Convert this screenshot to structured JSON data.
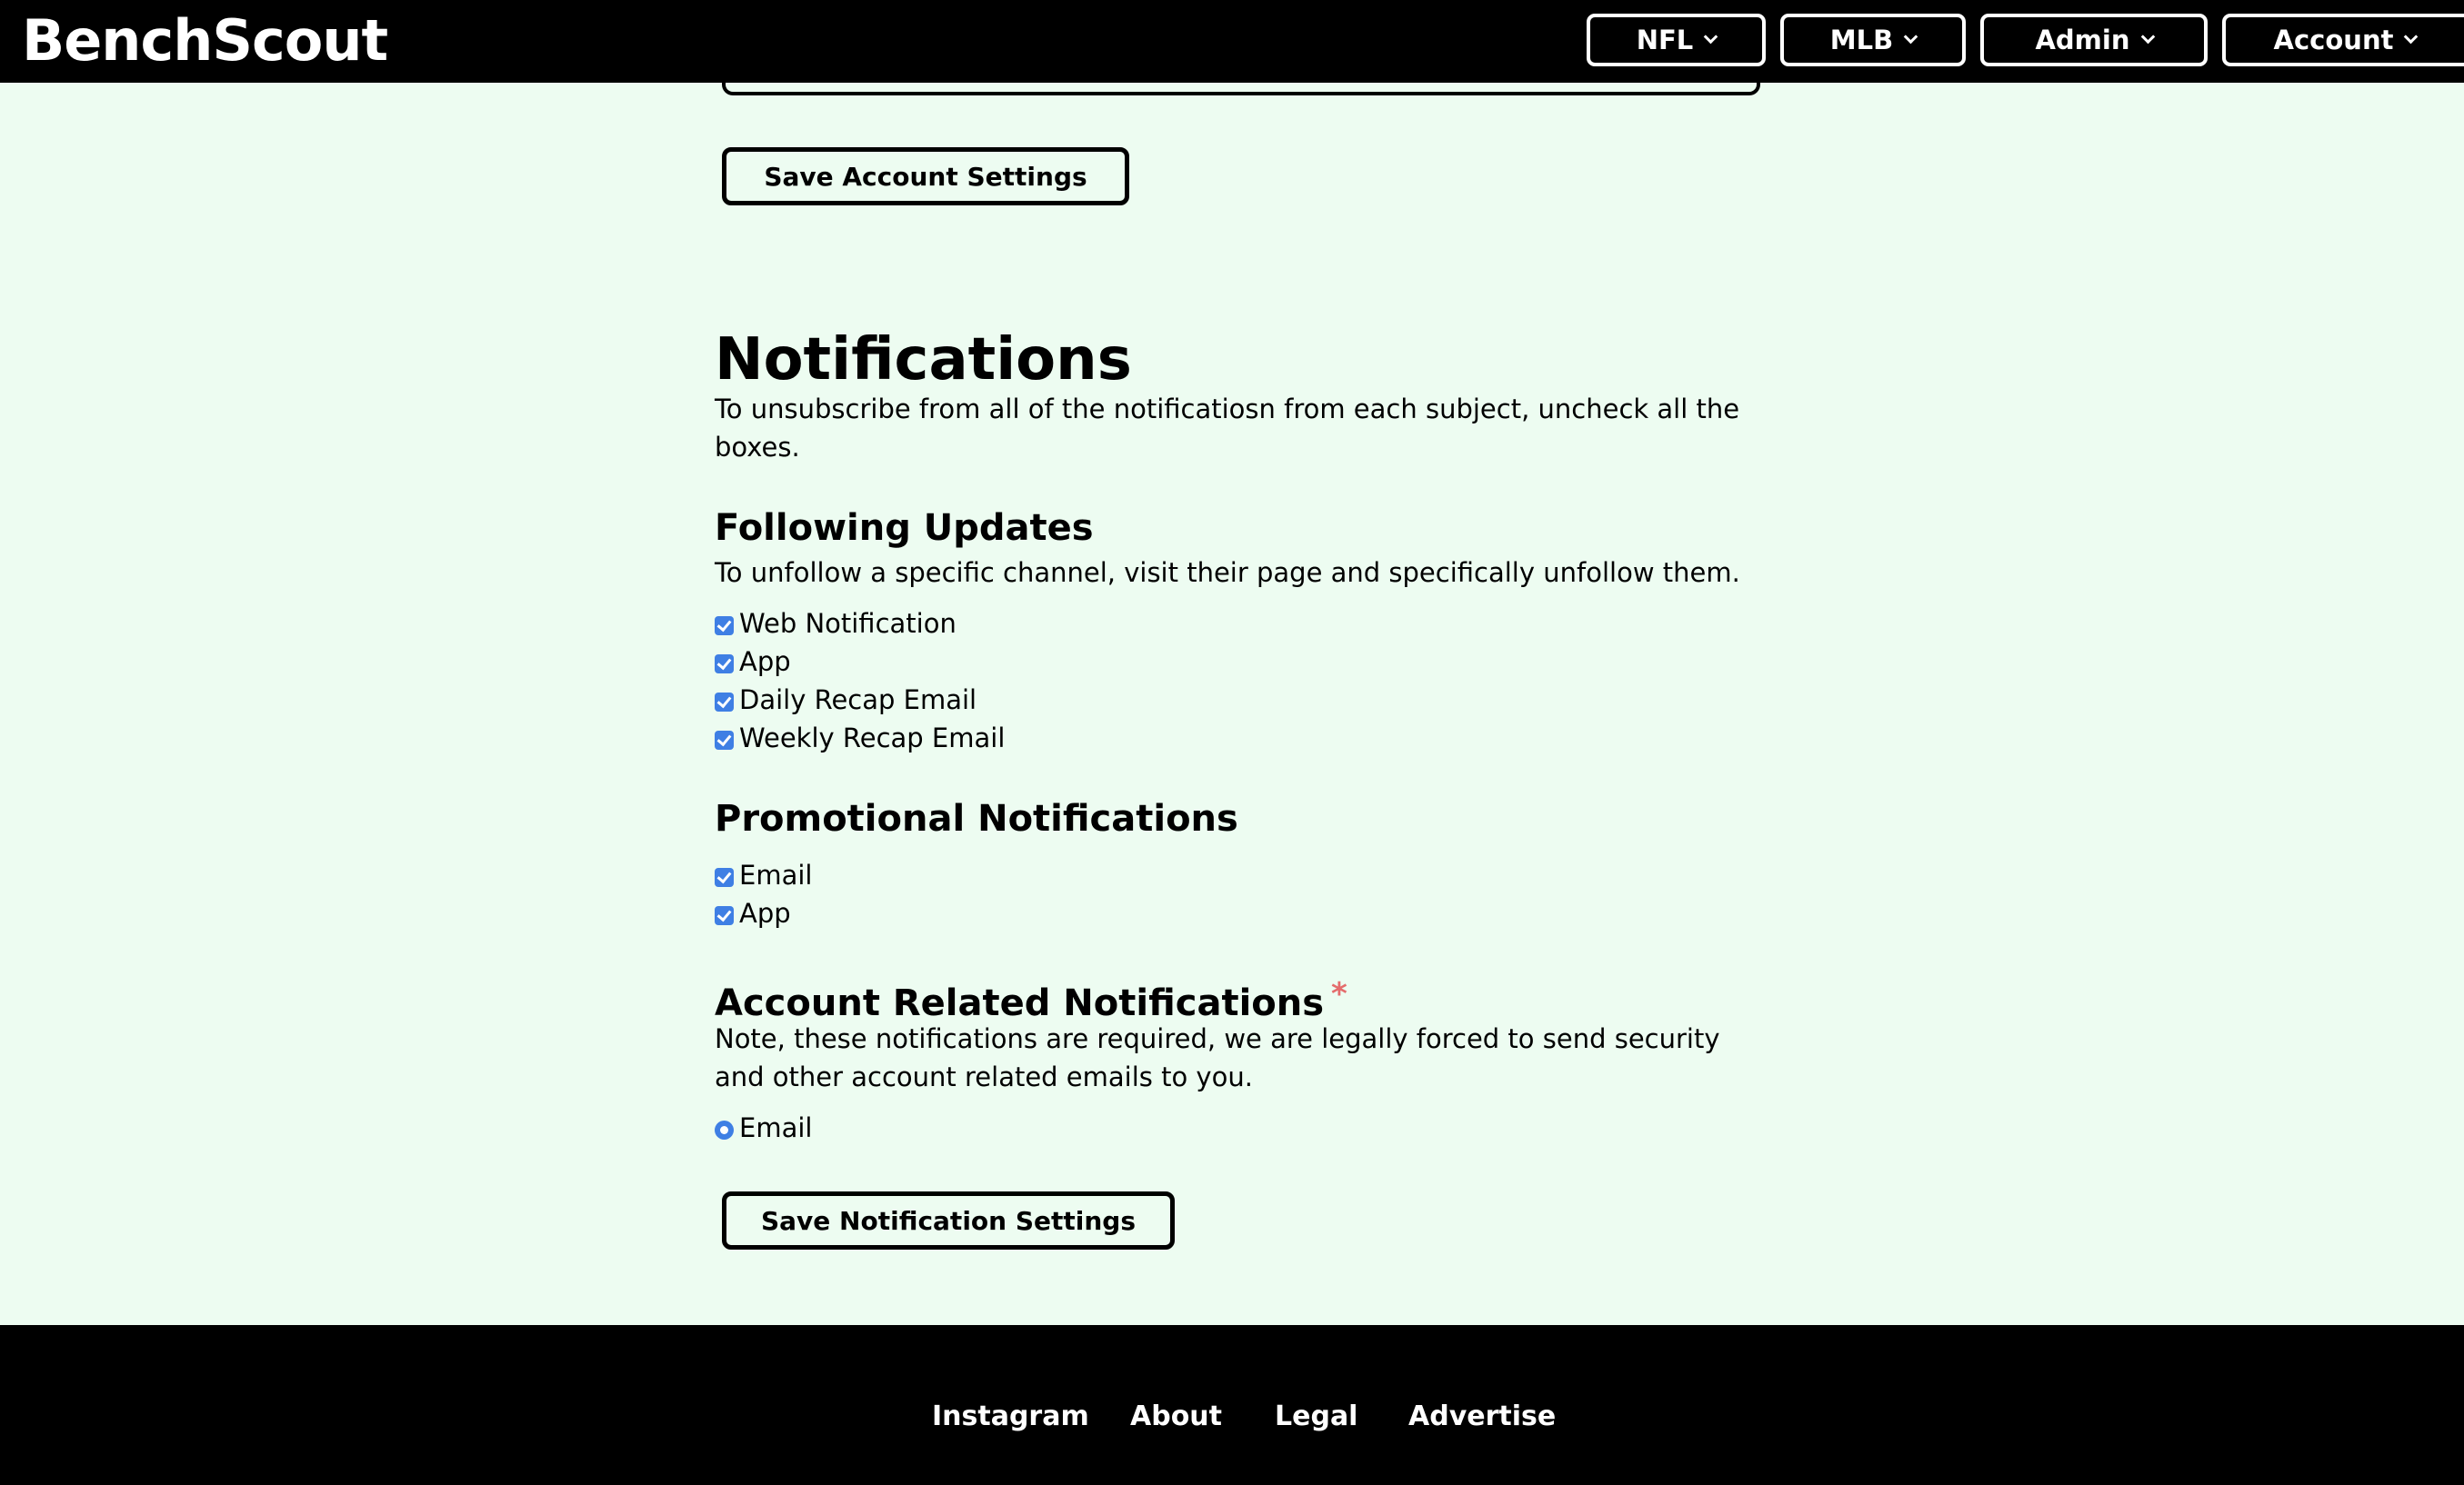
{
  "header": {
    "logo": "BenchScout",
    "nav": [
      {
        "label": "NFL"
      },
      {
        "label": "MLB"
      },
      {
        "label": "Admin"
      },
      {
        "label": "Account"
      }
    ]
  },
  "account_settings": {
    "save_label": "Save Account Settings"
  },
  "notifications": {
    "title": "Notifications",
    "intro": "To unsubscribe from all of the notificatiosn from each subject, uncheck all the boxes.",
    "following": {
      "title": "Following Updates",
      "desc": "To unfollow a specific channel, visit their page and specifically unfollow them.",
      "options": [
        {
          "label": "Web Notification",
          "checked": true
        },
        {
          "label": "App",
          "checked": true
        },
        {
          "label": "Daily Recap Email",
          "checked": true
        },
        {
          "label": "Weekly Recap Email",
          "checked": true
        }
      ]
    },
    "promotional": {
      "title": "Promotional Notifications",
      "options": [
        {
          "label": "Email",
          "checked": true
        },
        {
          "label": "App",
          "checked": true
        }
      ]
    },
    "account_related": {
      "title": "Account Related Notifications",
      "required_mark": "*",
      "desc": "Note, these notifications are required, we are legally forced to send security and other account related emails to you.",
      "options": [
        {
          "label": "Email",
          "selected": true
        }
      ]
    },
    "save_label": "Save Notification Settings"
  },
  "footer": {
    "links": [
      {
        "label": "Instagram"
      },
      {
        "label": "About"
      },
      {
        "label": "Legal"
      },
      {
        "label": "Advertise"
      }
    ]
  },
  "colors": {
    "page_bg": "#edfcf1",
    "header_bg": "#000000",
    "accent": "#3f7fe4",
    "required": "#e46c6c"
  }
}
